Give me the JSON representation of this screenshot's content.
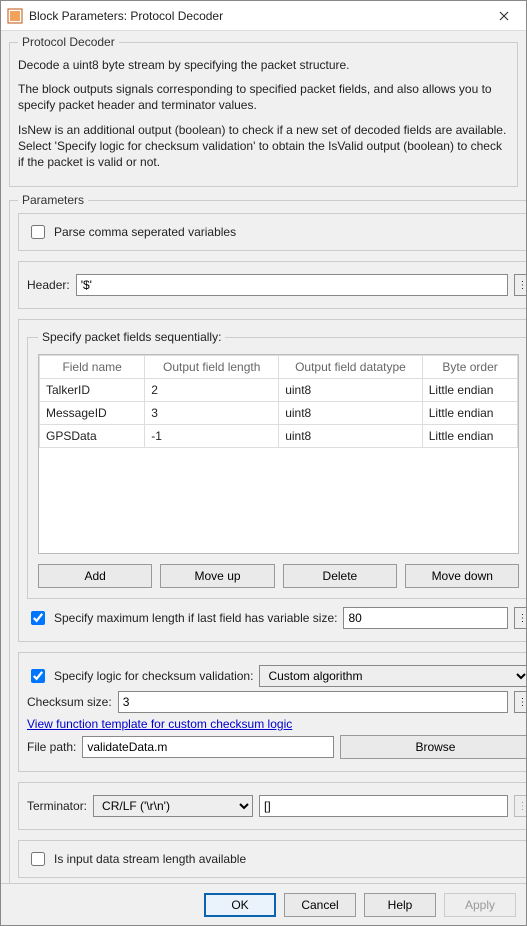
{
  "title": "Block Parameters: Protocol Decoder",
  "group": {
    "legend": "Protocol Decoder",
    "desc1": "Decode a uint8 byte stream by specifying the packet structure.",
    "desc2": "The block outputs signals corresponding to specified packet fields, and also allows you to specify packet header and terminator values.",
    "desc3": "IsNew is an additional output (boolean) to check if a new set of decoded fields are available. Select 'Specify logic for checksum validation' to obtain the IsValid output (boolean) to check if the packet is valid or not."
  },
  "params_legend": "Parameters",
  "parse_csv": {
    "label": "Parse comma seperated variables",
    "checked": false
  },
  "header": {
    "label": "Header:",
    "value": "'$'"
  },
  "fields_legend": "Specify packet fields sequentially:",
  "table": {
    "cols": [
      "Field name",
      "Output field length",
      "Output field datatype",
      "Byte order"
    ],
    "rows": [
      {
        "name": "TalkerID",
        "len": "2",
        "type": "uint8",
        "order": "Little endian"
      },
      {
        "name": "MessageID",
        "len": "3",
        "type": "uint8",
        "order": "Little endian"
      },
      {
        "name": "GPSData",
        "len": "-1",
        "type": "uint8",
        "order": "Little endian"
      }
    ]
  },
  "buttons": {
    "add": "Add",
    "up": "Move up",
    "del": "Delete",
    "down": "Move down"
  },
  "maxlen": {
    "label": "Specify maximum length if last field has variable size:",
    "checked": true,
    "value": "80"
  },
  "checksum": {
    "label": "Specify logic for checksum validation:",
    "checked": true,
    "algo": "Custom algorithm",
    "size_label": "Checksum size:",
    "size_value": "3",
    "link": "View function template for custom checksum logic",
    "filepath_label": "File path:",
    "filepath_value": "validateData.m",
    "browse": "Browse"
  },
  "terminator": {
    "label": "Terminator:",
    "selected": "CR/LF ('\\r\\n')",
    "custom": "[]"
  },
  "streamlen": {
    "label": "Is input data stream length available",
    "checked": false
  },
  "footer": {
    "ok": "OK",
    "cancel": "Cancel",
    "help": "Help",
    "apply": "Apply"
  }
}
